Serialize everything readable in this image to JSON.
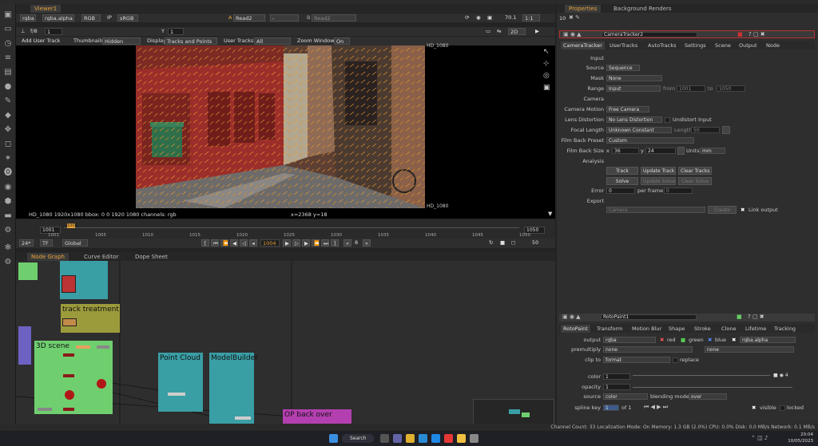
{
  "viewer": {
    "tab_label": "Viewer1",
    "row1": {
      "channels": "rgba",
      "channel_alpha": "rgba.alpha",
      "colorspace_mode": "RGB",
      "ip": "IP",
      "colorspace": "sRGB",
      "input_a_letter": "A",
      "input_a": "Read2",
      "input_mid": "-",
      "input_b_letter": "B",
      "input_b": "Read2",
      "zoom": "70.1",
      "ratio": "1:1"
    },
    "row2": {
      "fstop": "f/8",
      "frame_field": "1",
      "y_label": "Y",
      "y_value": "1",
      "view_mode": "2D"
    },
    "row3": {
      "add_user_track": "Add User Track",
      "thumbnails_label": "Thumbnails",
      "thumbnails_value": "Hidden",
      "display_label": "Display",
      "display_value": "Tracks and Points",
      "user_tracks_label": "User Tracks",
      "user_tracks_value": "All",
      "zoom_window_label": "Zoom Window",
      "zoom_window_value": "On"
    },
    "format_label_top": "HD_1080",
    "format_label_bottom": "HD_1080",
    "info_left": "HD_1080 1920x1080  bbox: 0 0 1920 1080 channels: rgb",
    "info_coords": "x=2368 y=18"
  },
  "timeline": {
    "start": "1001",
    "end": "1050",
    "current_marker": "1003",
    "ticks": [
      "1001",
      "1005",
      "1010",
      "1015",
      "1020",
      "1025",
      "1030",
      "1035",
      "1040",
      "1045",
      "1050"
    ],
    "fps": "24*",
    "tf": "TF",
    "scope": "Global",
    "current_frame": "1004",
    "increment": "8",
    "playback_end": "50"
  },
  "nodegraph": {
    "tabs": [
      "Node Graph",
      "Curve Editor",
      "Dope Sheet"
    ],
    "nodes": {
      "track_treatment": "track treatment",
      "scene_3d": "3D scene",
      "point_cloud": "Point Cloud",
      "model_builder": "ModelBuilder",
      "op_back_over": "OP back over"
    }
  },
  "properties": {
    "tabs": [
      "Properties",
      "Background Renders"
    ],
    "counter": "10",
    "camera_tracker": {
      "name": "CameraTracker2",
      "tabs": [
        "CameraTracker",
        "UserTracks",
        "AutoTracks",
        "Settings",
        "Scene",
        "Output",
        "Node"
      ],
      "section_input": "Input",
      "source_label": "Source",
      "source_value": "Sequence",
      "mask_label": "Mask",
      "mask_value": "None",
      "range_label": "Range",
      "range_value": "Input",
      "from_label": "from",
      "from_value": "1001",
      "to_label": "to",
      "to_value": "1050",
      "section_camera": "Camera",
      "camera_motion_label": "Camera Motion",
      "camera_motion_value": "Free Camera",
      "lens_distortion_label": "Lens Distortion",
      "lens_distortion_value": "No Lens Distortion",
      "undistort_label": "Undistort Input",
      "focal_length_label": "Focal Length",
      "focal_length_value": "Unknown Constant",
      "length_label": "Length",
      "length_value": "50",
      "film_back_preset_label": "Film Back Preset",
      "film_back_preset_value": "Custom",
      "film_back_size_label": "Film Back Size",
      "x_label": "x",
      "x_value": "36",
      "y_label": "y",
      "y_value": "24",
      "units_label": "Units",
      "units_value": "mm",
      "section_analysis": "Analysis",
      "track_btn": "Track",
      "update_track_btn": "Update Track",
      "clear_tracks_btn": "Clear Tracks",
      "solve_btn": "Solve",
      "update_solve_btn": "Update Solve",
      "clear_solve_btn": "Clear Solve",
      "error_label": "Error",
      "error_value": "0",
      "per_frame_label": "per frame",
      "per_frame_value": "0",
      "section_export": "Export",
      "export_value": "Camera",
      "create_btn": "Create",
      "link_output_label": "Link output"
    },
    "roto_paint": {
      "name": "RotoPaint1",
      "tabs": [
        "RotoPaint",
        "Transform",
        "Motion Blur",
        "Shape",
        "Stroke",
        "Clone",
        "Lifetime",
        "Tracking"
      ],
      "output_label": "output",
      "output_value": "rgba",
      "red": "red",
      "green": "green",
      "blue": "blue",
      "alpha_value": "rgba.alpha",
      "premultiply_label": "premultiply",
      "premultiply_value": "none",
      "premultiply_value2": "none",
      "clip_to_label": "clip to",
      "clip_to_value": "format",
      "replace_label": "replace",
      "color_label": "color",
      "color_value": "1",
      "opacity_label": "opacity",
      "opacity_value": "1",
      "source_label": "source",
      "source_value": "color",
      "blending_mode_label": "blending mode",
      "blending_mode_value": "over",
      "spline_key_label": "spline key",
      "spline_key_value": "1",
      "spline_of_label": "of 1",
      "visible_label": "visible",
      "locked_label": "locked"
    }
  },
  "statusbar": {
    "text": "Channel Count: 33  Localization Mode: On  Memory: 1.3 GB (2.0%)  CPU: 0.0%  Disk: 0.0 MB/s  Network: 0.1 MB/s"
  },
  "taskbar": {
    "search": "Search",
    "time": "20:04",
    "date": "10/05/2023"
  },
  "colors": {
    "accent": "#e6a23a",
    "node_teal": "#3a9ea5",
    "node_green": "#6fcf6f",
    "node_olive": "#9c9b3c",
    "node_purple": "#b43fb0",
    "selected_red": "#b83232"
  }
}
